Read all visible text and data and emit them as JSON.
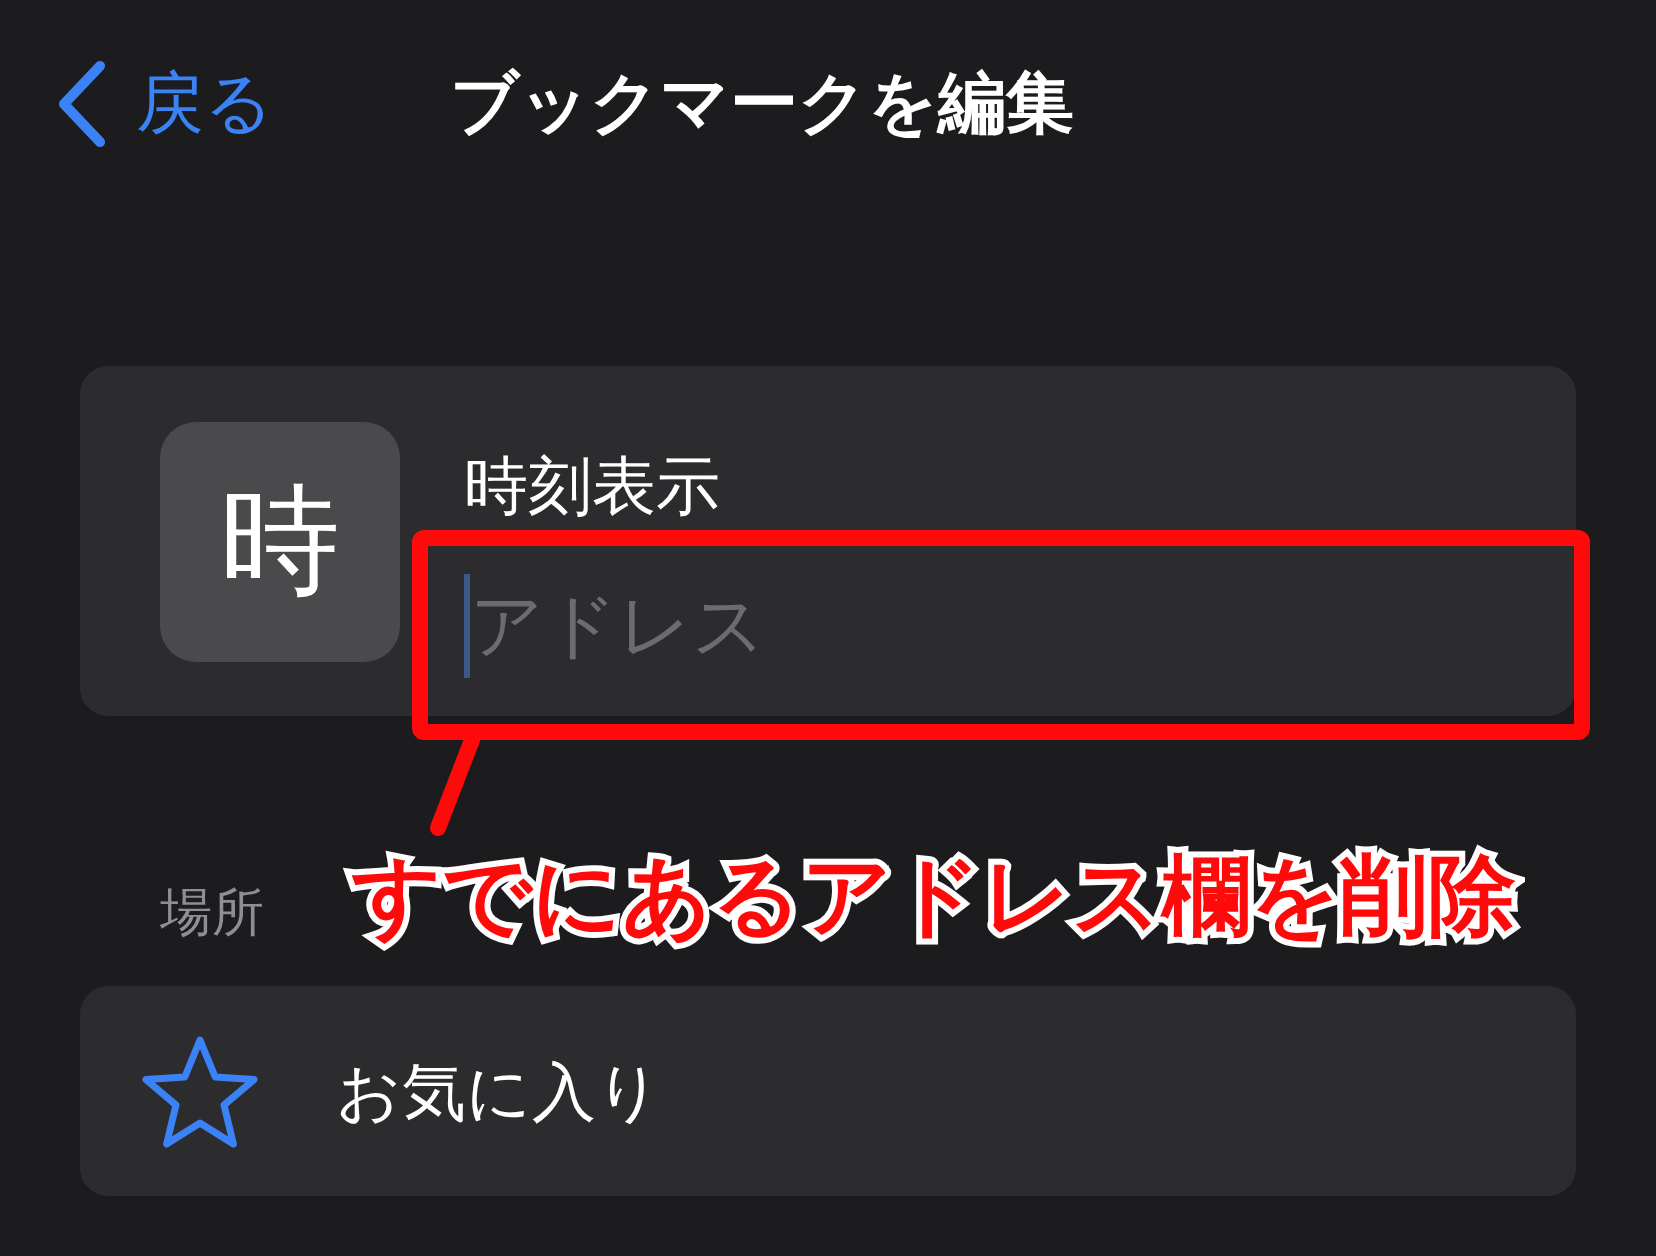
{
  "nav": {
    "back": "戻る",
    "title": "ブックマークを編集"
  },
  "bookmark": {
    "icon_letter": "時",
    "name": "時刻表示",
    "address": {
      "placeholder": "アドレス",
      "focused": true
    }
  },
  "annotation": {
    "text": "すでにあるアドレス欄を削除"
  },
  "location": {
    "label": "場所",
    "folder": "お気に入り"
  }
}
